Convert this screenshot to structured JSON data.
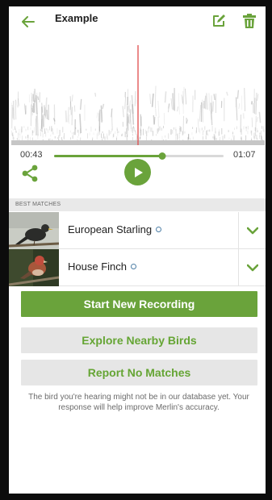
{
  "header": {
    "title": "Example",
    "back_icon": "arrow-left-icon",
    "edit_icon": "edit-icon",
    "delete_icon": "trash-icon"
  },
  "player": {
    "current_time": "00:43",
    "total_time": "01:07",
    "progress": 0.64,
    "share_icon": "share-icon",
    "play_icon": "play-icon"
  },
  "matches": {
    "section_label": "BEST MATCHES",
    "items": [
      {
        "name": "European Starling",
        "expand_icon": "chevron-down-icon"
      },
      {
        "name": "House Finch",
        "expand_icon": "chevron-down-icon"
      }
    ]
  },
  "actions": {
    "start_new": "Start New Recording",
    "explore": "Explore Nearby Birds",
    "report": "Report No Matches"
  },
  "footer_note": "The bird you're hearing might not be in our database yet. Your response will help improve Merlin's accuracy.",
  "colors": {
    "accent": "#6aa33b",
    "playhead": "#e04a4a",
    "secondary_bg": "#e6e6e6"
  }
}
